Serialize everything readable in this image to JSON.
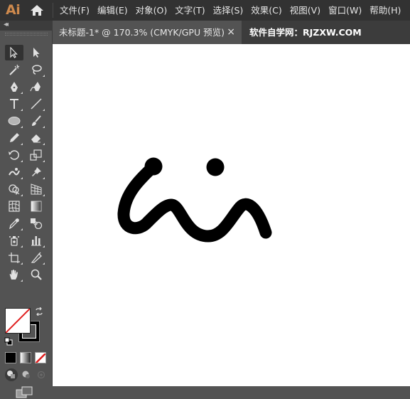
{
  "app": {
    "logo": "Ai"
  },
  "menu": {
    "items": [
      "文件(F)",
      "编辑(E)",
      "对象(O)",
      "文字(T)",
      "选择(S)",
      "效果(C)",
      "视图(V)",
      "窗口(W)",
      "帮助(H)"
    ]
  },
  "document": {
    "tab_title": "未标题-1* @ 170.3% (CMYK/GPU 预览)",
    "close_label": "×"
  },
  "watermark": {
    "text": "软件自学网：RJZXW.COM"
  },
  "panel": {
    "collapse_label": "◂◂"
  },
  "toolbar": {
    "tools": [
      "selection-tool",
      "direct-selection-tool",
      "magic-wand-tool",
      "lasso-tool",
      "pen-tool",
      "curvature-tool",
      "type-tool",
      "line-segment-tool",
      "ellipse-tool",
      "paintbrush-tool",
      "pencil-tool",
      "eraser-tool",
      "rotate-tool",
      "scale-tool",
      "warp-tool",
      "puppet-warp-tool",
      "shape-builder-tool",
      "perspective-grid-tool",
      "mesh-tool",
      "gradient-tool",
      "eyedropper-tool",
      "blend-tool",
      "symbol-sprayer-tool",
      "column-graph-tool",
      "artboard-tool",
      "slice-tool",
      "hand-tool",
      "zoom-tool"
    ],
    "selected_tool": "selection-tool"
  },
  "colors": {
    "fill": "none",
    "stroke": "#000000",
    "accent": "#cf8a4d"
  }
}
